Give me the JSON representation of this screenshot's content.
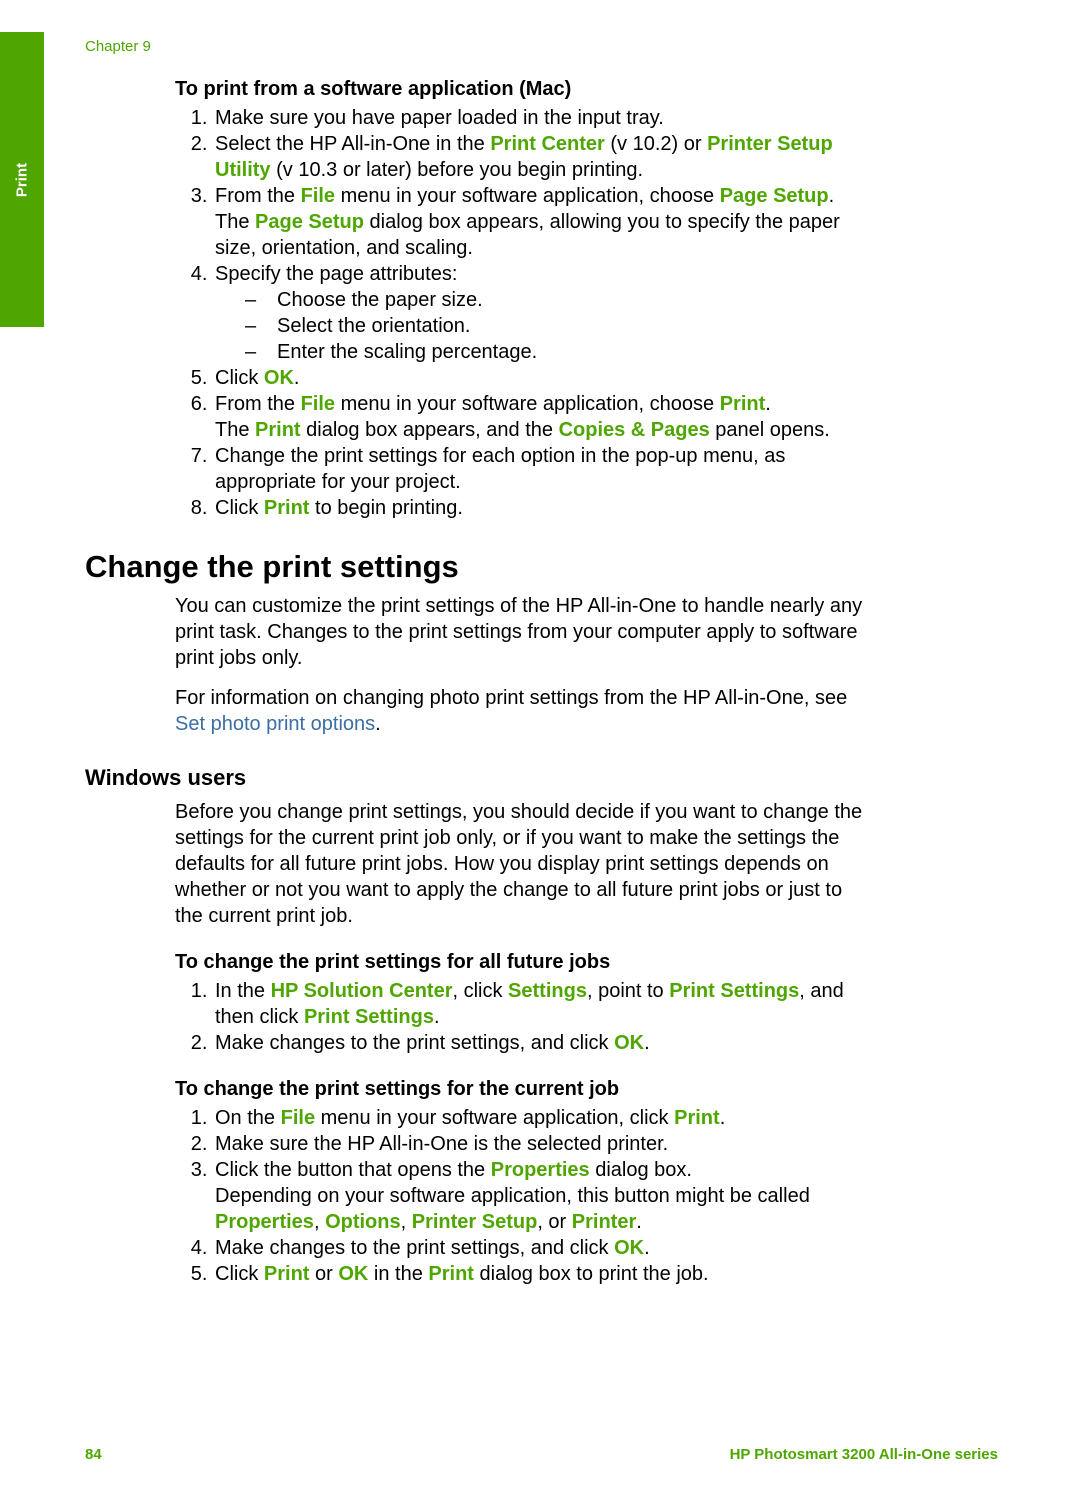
{
  "sideTab": "Print",
  "chapter": "Chapter 9",
  "macSection": {
    "heading": "To print from a software application (Mac)",
    "step1": "Make sure you have paper loaded in the input tray.",
    "step2_a": "Select the HP All-in-One in the ",
    "step2_term1": "Print Center",
    "step2_b": " (v 10.2) or ",
    "step2_term2": "Printer Setup Utility",
    "step2_c": " (v 10.3 or later) before you begin printing.",
    "step3_a": "From the ",
    "step3_term1": "File",
    "step3_b": " menu in your software application, choose ",
    "step3_term2": "Page Setup",
    "step3_c": ".",
    "step3_line2_a": "The ",
    "step3_line2_term": "Page Setup",
    "step3_line2_b": " dialog box appears, allowing you to specify the paper size, orientation, and scaling.",
    "step4": "Specify the page attributes:",
    "step4_sub1": "Choose the paper size.",
    "step4_sub2": "Select the orientation.",
    "step4_sub3": "Enter the scaling percentage.",
    "step5_a": "Click ",
    "step5_term": "OK",
    "step5_b": ".",
    "step6_a": "From the ",
    "step6_term1": "File",
    "step6_b": " menu in your software application, choose ",
    "step6_term2": "Print",
    "step6_c": ".",
    "step6_line2_a": "The ",
    "step6_line2_term1": "Print",
    "step6_line2_b": " dialog box appears, and the ",
    "step6_line2_term2": "Copies & Pages",
    "step6_line2_c": " panel opens.",
    "step7": "Change the print settings for each option in the pop-up menu, as appropriate for your project.",
    "step8_a": "Click ",
    "step8_term": "Print",
    "step8_b": " to begin printing."
  },
  "changeSection": {
    "heading": "Change the print settings",
    "para1": "You can customize the print settings of the HP All-in-One to handle nearly any print task. Changes to the print settings from your computer apply to software print jobs only.",
    "para2_a": "For information on changing photo print settings from the HP All-in-One, see ",
    "para2_link": "Set photo print options",
    "para2_b": "."
  },
  "windowsSection": {
    "heading": "Windows users",
    "para": "Before you change print settings, you should decide if you want to change the settings for the current print job only, or if you want to make the settings the defaults for all future print jobs. How you display print settings depends on whether or not you want to apply the change to all future print jobs or just to the current print job.",
    "futureHeading": "To change the print settings for all future jobs",
    "future_step1_a": "In the ",
    "future_step1_term1": "HP Solution Center",
    "future_step1_b": ", click ",
    "future_step1_term2": "Settings",
    "future_step1_c": ", point to ",
    "future_step1_term3": "Print Settings",
    "future_step1_d": ", and then click ",
    "future_step1_term4": "Print Settings",
    "future_step1_e": ".",
    "future_step2_a": "Make changes to the print settings, and click ",
    "future_step2_term": "OK",
    "future_step2_b": ".",
    "currentHeading": "To change the print settings for the current job",
    "current_step1_a": "On the ",
    "current_step1_term1": "File",
    "current_step1_b": " menu in your software application, click ",
    "current_step1_term2": "Print",
    "current_step1_c": ".",
    "current_step2": "Make sure the HP All-in-One is the selected printer.",
    "current_step3_a": "Click the button that opens the ",
    "current_step3_term1": "Properties",
    "current_step3_b": " dialog box.",
    "current_step3_line2_a": "Depending on your software application, this button might be called ",
    "current_step3_line2_term1": "Properties",
    "current_step3_line2_b": ", ",
    "current_step3_line2_term2": "Options",
    "current_step3_line2_c": ", ",
    "current_step3_line2_term3": "Printer Setup",
    "current_step3_line2_d": ", or ",
    "current_step3_line2_term4": "Printer",
    "current_step3_line2_e": ".",
    "current_step4_a": "Make changes to the print settings, and click ",
    "current_step4_term": "OK",
    "current_step4_b": ".",
    "current_step5_a": "Click ",
    "current_step5_term1": "Print",
    "current_step5_b": " or ",
    "current_step5_term2": "OK",
    "current_step5_c": " in the ",
    "current_step5_term3": "Print",
    "current_step5_d": " dialog box to print the job."
  },
  "footer": {
    "page": "84",
    "series": "HP Photosmart 3200 All-in-One series"
  }
}
